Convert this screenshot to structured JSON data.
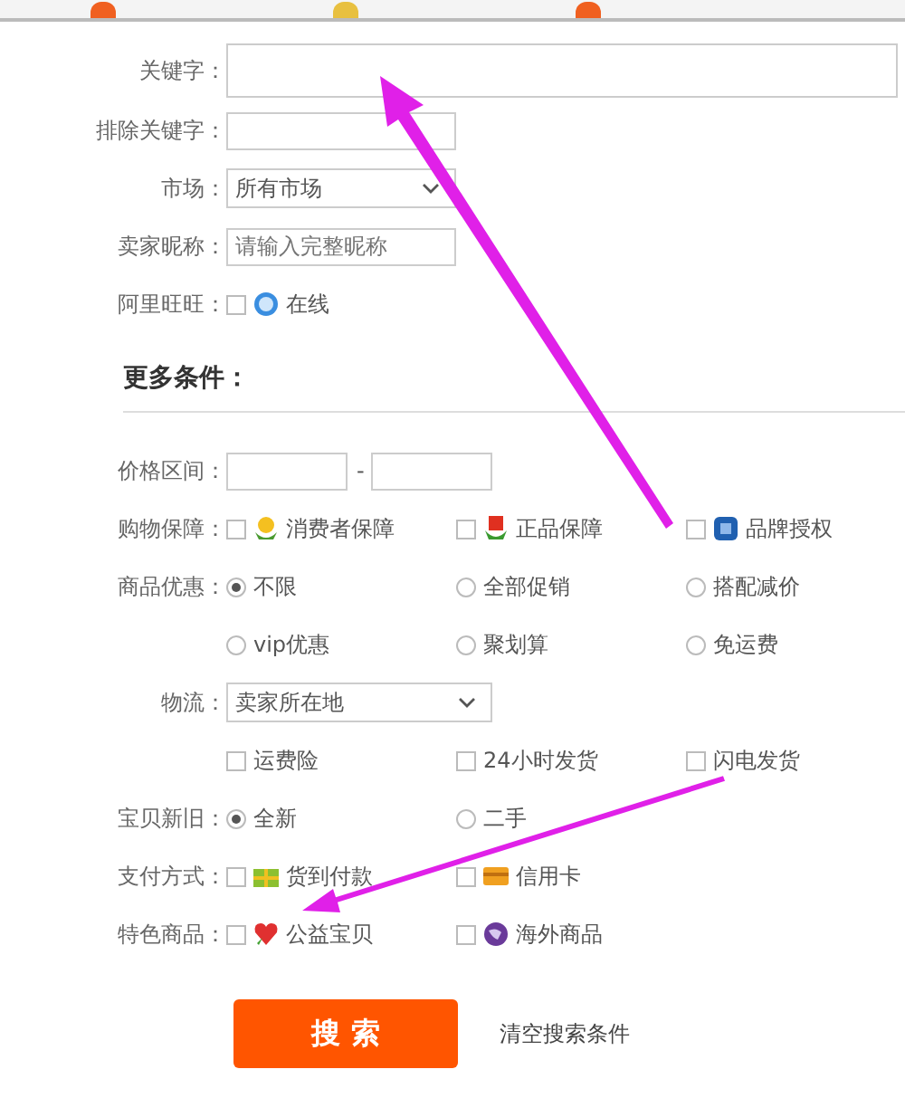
{
  "keyword": {
    "label": "关键字："
  },
  "exclude_keyword": {
    "label": "排除关键字："
  },
  "market": {
    "label": "市场：",
    "value": "所有市场"
  },
  "seller_nick": {
    "label": "卖家昵称：",
    "placeholder": "请输入完整昵称"
  },
  "wangwang": {
    "label": "阿里旺旺：",
    "options": [
      {
        "label": "在线",
        "checked": false
      }
    ]
  },
  "more_title": "更多条件：",
  "price_range": {
    "label": "价格区间：",
    "separator": "-"
  },
  "guarantee": {
    "label": "购物保障：",
    "options": [
      {
        "label": "消费者保障",
        "checked": false
      },
      {
        "label": "正品保障",
        "checked": false
      },
      {
        "label": "品牌授权",
        "checked": false
      }
    ]
  },
  "discount": {
    "label": "商品优惠：",
    "options": [
      {
        "label": "不限",
        "selected": true
      },
      {
        "label": "全部促销",
        "selected": false
      },
      {
        "label": "搭配减价",
        "selected": false
      },
      {
        "label": "vip优惠",
        "selected": false
      },
      {
        "label": "聚划算",
        "selected": false
      },
      {
        "label": "免运费",
        "selected": false
      }
    ]
  },
  "logistics": {
    "label": "物流：",
    "value": "卖家所在地",
    "options": [
      {
        "label": "运费险",
        "checked": false
      },
      {
        "label": "24小时发货",
        "checked": false
      },
      {
        "label": "闪电发货",
        "checked": false
      }
    ]
  },
  "condition": {
    "label": "宝贝新旧：",
    "options": [
      {
        "label": "全新",
        "selected": true
      },
      {
        "label": "二手",
        "selected": false
      }
    ]
  },
  "payment": {
    "label": "支付方式：",
    "options": [
      {
        "label": "货到付款",
        "checked": false
      },
      {
        "label": "信用卡",
        "checked": false
      }
    ]
  },
  "special": {
    "label": "特色商品：",
    "options": [
      {
        "label": "公益宝贝",
        "checked": false
      },
      {
        "label": "海外商品",
        "checked": false
      }
    ]
  },
  "search_button": "搜 索",
  "clear_link": "清空搜索条件"
}
